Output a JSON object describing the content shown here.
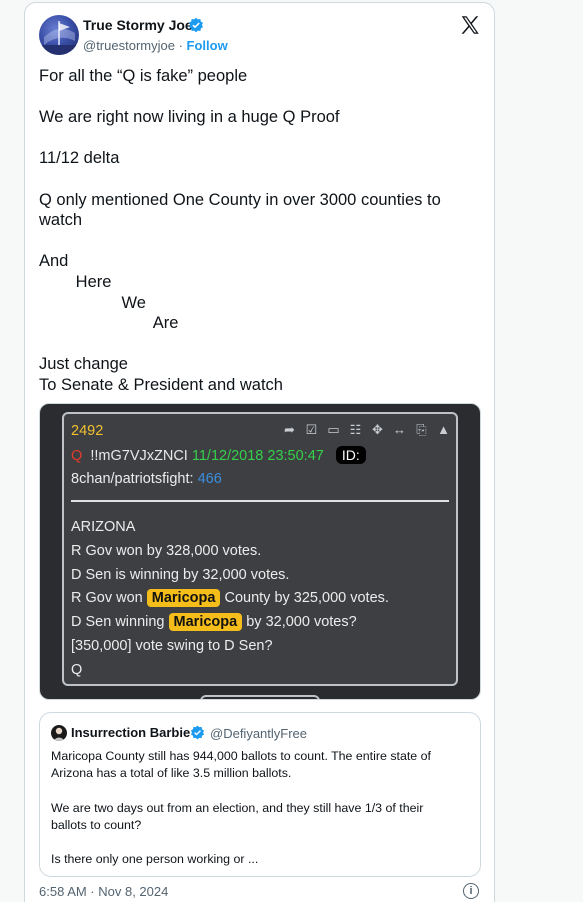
{
  "author": {
    "display_name": "True Stormy Joe",
    "handle": "@truestormyjoe",
    "separator": "·",
    "follow_label": "Follow"
  },
  "tweet_lines": [
    "For all the “Q is fake” people",
    "",
    "We are right now living in a huge Q Proof",
    "",
    "11/12 delta",
    "",
    "Q only mentioned One County in over 3000 counties to",
    "watch",
    "",
    "And",
    "        Here",
    "                  We",
    "                         Are",
    "",
    "Just change",
    "To Senate & President and watch"
  ],
  "qpost": {
    "number": "2492",
    "q": "Q",
    "tripcode": "!!mG7VJxZNCI",
    "datetime": "11/12/2018 23:50:47",
    "id_label": "ID:",
    "board": "8chan/patriotsfight:",
    "post_number": "466",
    "line1": "ARIZONA",
    "line2": "R Gov won by 328,000 votes.",
    "line3": "D Sen is winning by 32,000 votes.",
    "line4_pre": "R Gov won",
    "line4_hl": "Maricopa",
    "line4_post": "County by 325,000 votes.",
    "line5_pre": "D Sen winning",
    "line5_hl": "Maricopa",
    "line5_post": "by 32,000 votes?",
    "line6": "[350,000] vote swing to D Sen?",
    "line7": "Q"
  },
  "quote": {
    "display_name": "Insurrection Barbie",
    "handle": "@DefiyantlyFree",
    "text_lines": [
      "Maricopa County still has 944,000 ballots to count. The entire state of",
      "Arizona has a total of like 3.5 million ballots.",
      "",
      "We are two days out from an election, and they still have 1/3 of their",
      "ballots to count?",
      "",
      "Is there only one person working or ..."
    ]
  },
  "timestamp": "6:58 AM · Nov 8, 2024",
  "colors": {
    "verified_blue": "#1d9bf0",
    "follow_blue": "#1d9bf0",
    "highlight_yellow": "#f4bd1a",
    "q_date_green": "#35d04a",
    "q_number_yellow": "#f2c12e"
  },
  "icons": {
    "close": "x-logo-icon",
    "verified": "verified-badge-icon",
    "info": "info-icon"
  }
}
